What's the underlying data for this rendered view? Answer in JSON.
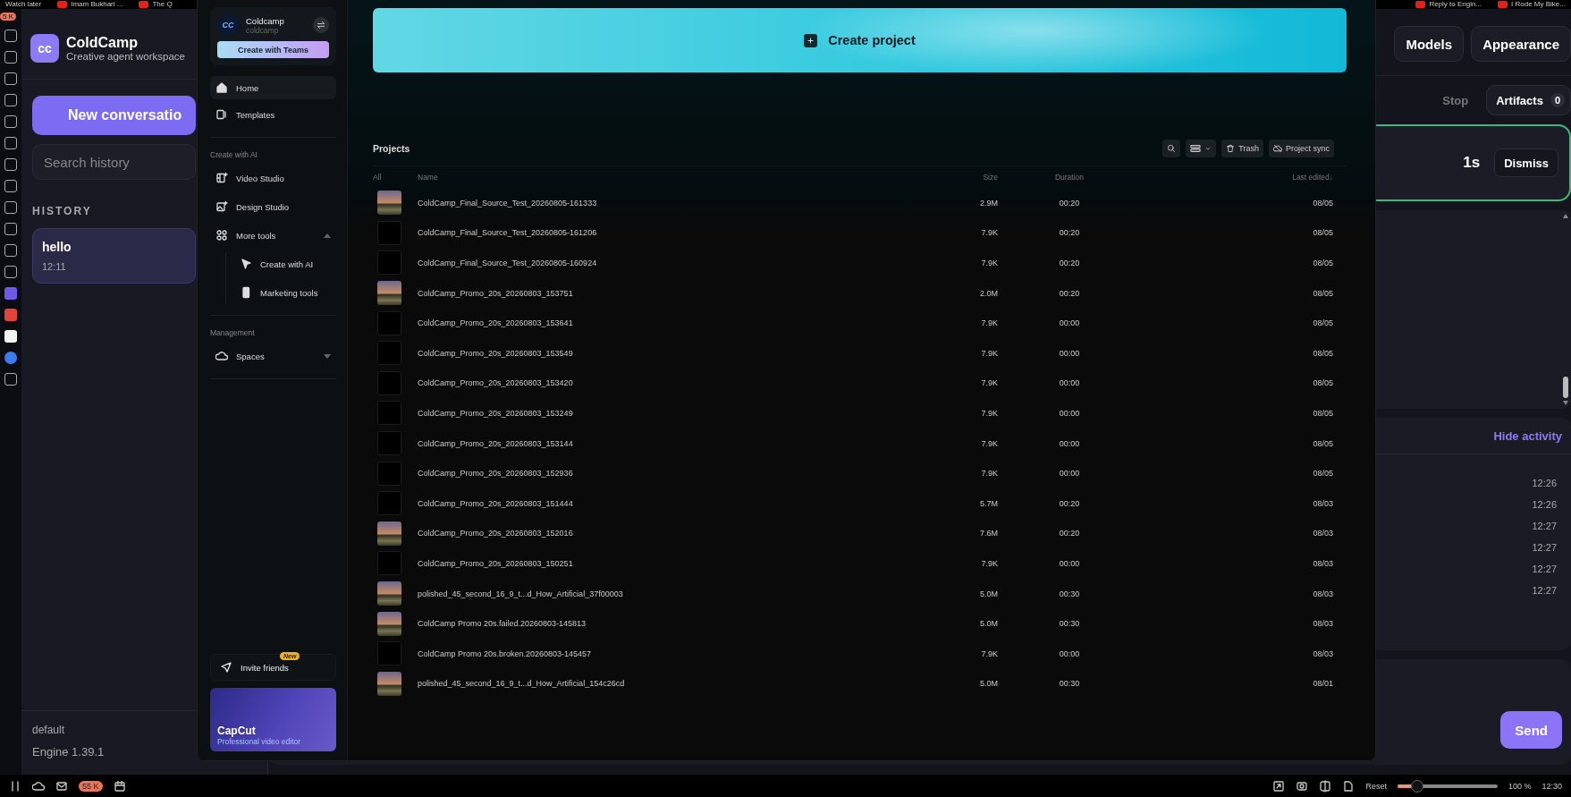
{
  "bookmarks": {
    "left": [
      {
        "label": "Watch later",
        "icon": false
      },
      {
        "label": "Imam Bukhari ...",
        "icon": true
      },
      {
        "label": "The Q",
        "icon": true
      }
    ],
    "right": [
      {
        "label": "Reply to Engin...",
        "icon": true
      },
      {
        "label": "I Rode My Bike...",
        "icon": true
      }
    ]
  },
  "browser_sidebar": {
    "badge": "5 K"
  },
  "app": {
    "logo": "cc",
    "title": "ColdCamp",
    "subtitle": "Creative agent workspace",
    "new_button": "New conversatio",
    "search": {
      "placeholder": "Search history"
    },
    "history_heading": "HISTORY",
    "history": [
      {
        "title": "hello",
        "time": "12:11",
        "selected": true
      }
    ],
    "profile": "default",
    "version": "Engine 1.39.1"
  },
  "main": {
    "header_buttons": [
      "Models",
      "Appearance"
    ],
    "stop": "Stop",
    "artifacts": {
      "label": "Artifacts",
      "count": "0"
    },
    "status_card": {
      "elapsed": "1s",
      "dismiss": "Dismiss"
    },
    "activity": {
      "toggle": "Hide activity",
      "times": [
        "12:26",
        "12:26",
        "12:27",
        "12:27",
        "12:27",
        "12:27"
      ]
    },
    "send": "Send"
  },
  "capcut": {
    "account": {
      "avatar": "CC",
      "name": "Coldcamp",
      "handle": "coldcamp",
      "teams_button": "Create with Teams"
    },
    "nav": [
      {
        "label": "Home",
        "selected": true
      },
      {
        "label": "Templates",
        "selected": false
      }
    ],
    "sections": [
      {
        "heading": "Create with AI",
        "items": [
          {
            "label": "Video Studio"
          },
          {
            "label": "Design Studio"
          },
          {
            "label": "More tools",
            "expanded": true,
            "children": [
              {
                "label": "Create with AI"
              },
              {
                "label": "Marketing tools"
              }
            ]
          }
        ]
      },
      {
        "heading": "Management",
        "items": [
          {
            "label": "Spaces",
            "expanded": false
          }
        ]
      }
    ],
    "invite": {
      "label": "Invite friends",
      "badge": "New"
    },
    "promo": {
      "title": "CapCut",
      "subtitle": "Professional video editor"
    },
    "create_button": "Create project",
    "projects": {
      "title": "Projects",
      "tools": [
        {
          "kind": "search"
        },
        {
          "kind": "view"
        },
        {
          "kind": "trash",
          "label": "Trash"
        },
        {
          "kind": "sync",
          "label": "Project sync"
        }
      ],
      "columns": [
        "All",
        "Name",
        "Size",
        "Duration",
        "Last edited↓"
      ],
      "rows": [
        {
          "kind": "photo",
          "name": "ColdCamp_Final_Source_Test_20260805-161333",
          "size": "2.9M",
          "duration": "00:20",
          "edited": "08/05"
        },
        {
          "kind": "blank",
          "name": "ColdCamp_Final_Source_Test_20260805-161206",
          "size": "7.9K",
          "duration": "00:20",
          "edited": "08/05"
        },
        {
          "kind": "blank",
          "name": "ColdCamp_Final_Source_Test_20260805-160924",
          "size": "7.9K",
          "duration": "00:20",
          "edited": "08/05"
        },
        {
          "kind": "photo",
          "name": "ColdCamp_Promo_20s_20260803_153751",
          "size": "2.0M",
          "duration": "00:20",
          "edited": "08/05"
        },
        {
          "kind": "blank",
          "name": "ColdCamp_Promo_20s_20260803_153641",
          "size": "7.9K",
          "duration": "00:00",
          "edited": "08/05"
        },
        {
          "kind": "blank",
          "name": "ColdCamp_Promo_20s_20260803_153549",
          "size": "7.9K",
          "duration": "00:00",
          "edited": "08/05"
        },
        {
          "kind": "blank",
          "name": "ColdCamp_Promo_20s_20260803_153420",
          "size": "7.9K",
          "duration": "00:00",
          "edited": "08/05"
        },
        {
          "kind": "blank",
          "name": "ColdCamp_Promo_20s_20260803_153249",
          "size": "7.9K",
          "duration": "00:00",
          "edited": "08/05"
        },
        {
          "kind": "blank",
          "name": "ColdCamp_Promo_20s_20260803_153144",
          "size": "7.9K",
          "duration": "00:00",
          "edited": "08/05"
        },
        {
          "kind": "blank",
          "name": "ColdCamp_Promo_20s_20260803_152936",
          "size": "7.9K",
          "duration": "00:00",
          "edited": "08/05"
        },
        {
          "kind": "blank",
          "name": "ColdCamp_Promo_20s_20260803_151444",
          "size": "5.7M",
          "duration": "00:20",
          "edited": "08/03"
        },
        {
          "kind": "photo",
          "name": "ColdCamp_Promo_20s_20260803_152016",
          "size": "7.6M",
          "duration": "00:20",
          "edited": "08/03"
        },
        {
          "kind": "blank",
          "name": "ColdCamp_Promo_20s_20260803_150251",
          "size": "7.9K",
          "duration": "00:00",
          "edited": "08/03"
        },
        {
          "kind": "photo",
          "name": "polished_45_second_16_9_t...d_How_Artificial_37f00003",
          "size": "5.0M",
          "duration": "00:30",
          "edited": "08/03"
        },
        {
          "kind": "photo",
          "name": "ColdCamp Promo 20s.failed.20260803-145813",
          "size": "5.0M",
          "duration": "00:30",
          "edited": "08/03"
        },
        {
          "kind": "blank",
          "name": "ColdCamp Promo 20s.broken.20260803-145457",
          "size": "7.9K",
          "duration": "00:00",
          "edited": "08/03"
        },
        {
          "kind": "photo",
          "name": "polished_45_second_16_9_t...d_How_Artificial_154c26cd",
          "size": "5.0M",
          "duration": "00:30",
          "edited": "08/01"
        }
      ]
    }
  },
  "taskbar": {
    "mail_badge": "55 K",
    "reset": "Reset",
    "zoom": {
      "level": 0.2
    },
    "zoom_reading": "100 %",
    "clock": "12:30"
  }
}
